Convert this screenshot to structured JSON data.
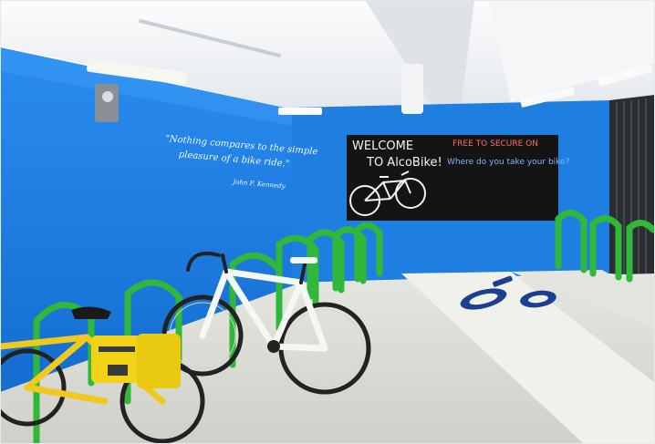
{
  "scene": {
    "description_colors": {
      "wall": "#1f7fe0",
      "ceiling": "#eef1f4",
      "floor": "#d8d9d4",
      "rack": "#2fb83a",
      "chalkboard": "#141414",
      "painted_lane": "#f2f2ee",
      "bike_symbol": "#1c3f8f",
      "white_bike_frame": "#f4f7f2",
      "yellow_bike_frame": "#f0c81e"
    },
    "wall_quote": {
      "lines": [
        "\"Nothing compares to the simple",
        "pleasure of a bike ride.\""
      ],
      "author": "John F. Kennedy"
    },
    "chalkboard": {
      "welcome_line1": "WELCOME",
      "welcome_line2": "TO  AlcoBike!",
      "red_text": "FREE TO SECURE ON",
      "blue_text": "Where do you take your bike?"
    }
  }
}
